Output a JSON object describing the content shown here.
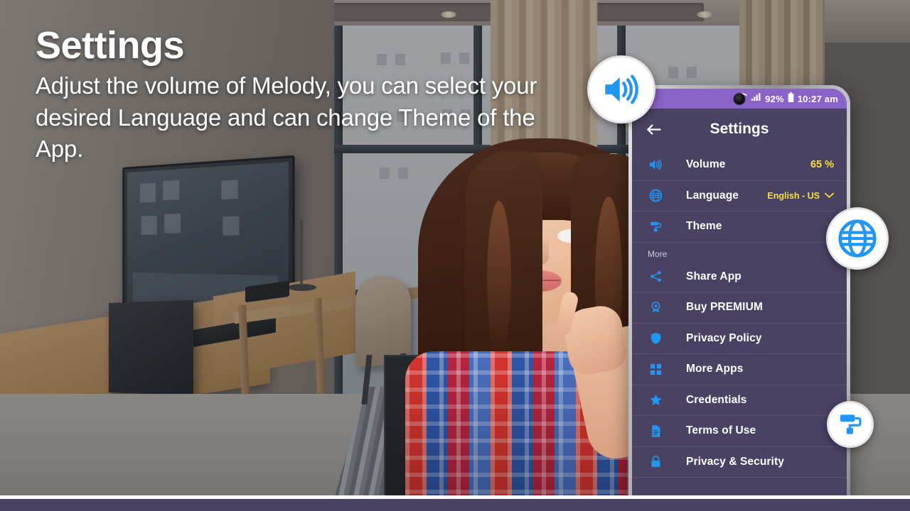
{
  "promo": {
    "title": "Settings",
    "description": "Adjust the volume of Melody, you can select your desired Language and can change Theme of the App."
  },
  "colors": {
    "app_background": "#4a4263",
    "status_bar": "#8a63c8",
    "accent_icon": "#2196f3",
    "value_yellow": "#f5e13c",
    "text_primary": "#ffffff",
    "section_label": "#cfc9dd"
  },
  "phone": {
    "status_bar": {
      "wifi_icon": "wifi-icon",
      "signal_icon": "signal-bars-icon",
      "battery_percent": "92%",
      "battery_icon": "battery-icon",
      "time": "10:27 am"
    },
    "app_bar": {
      "back_icon": "back-arrow-icon",
      "title": "Settings"
    },
    "sections": [
      {
        "label": "",
        "rows": [
          {
            "icon": "volume-speaker-icon",
            "label": "Volume",
            "value": "65 %",
            "value_size": "normal",
            "chevron": false
          },
          {
            "icon": "globe-icon",
            "label": "Language",
            "value": "English - US",
            "value_size": "small",
            "chevron": true
          },
          {
            "icon": "paint-roller-icon",
            "label": "Theme",
            "value": "",
            "value_size": "normal",
            "chevron": false
          }
        ]
      },
      {
        "label": "More",
        "rows": [
          {
            "icon": "share-icon",
            "label": "Share App",
            "value": "",
            "value_size": "normal",
            "chevron": false
          },
          {
            "icon": "medal-icon",
            "label": "Buy PREMIUM",
            "value": "",
            "value_size": "normal",
            "chevron": false
          },
          {
            "icon": "shield-icon",
            "label": "Privacy Policy",
            "value": "",
            "value_size": "normal",
            "chevron": false
          },
          {
            "icon": "apps-icon",
            "label": "More Apps",
            "value": "",
            "value_size": "normal",
            "chevron": false
          },
          {
            "icon": "star-icon",
            "label": "Credentials",
            "value": "",
            "value_size": "normal",
            "chevron": false
          },
          {
            "icon": "document-icon",
            "label": "Terms of Use",
            "value": "",
            "value_size": "normal",
            "chevron": false
          },
          {
            "icon": "lock-icon",
            "label": "Privacy & Security",
            "value": "",
            "value_size": "normal",
            "chevron": false
          }
        ]
      }
    ]
  },
  "badges": [
    {
      "name": "volume-badge",
      "icon": "volume-speaker-icon"
    },
    {
      "name": "language-badge",
      "icon": "globe-icon"
    },
    {
      "name": "theme-badge",
      "icon": "paint-roller-icon"
    }
  ]
}
